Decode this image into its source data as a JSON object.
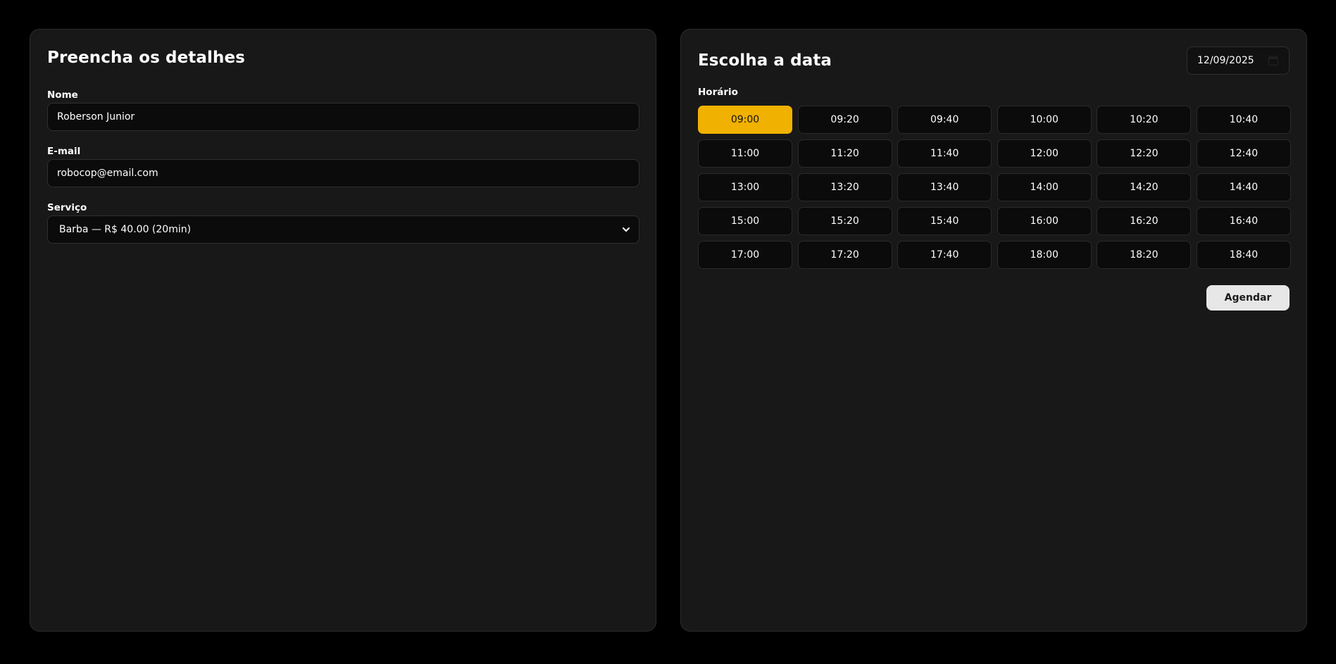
{
  "details": {
    "title": "Preencha os detalhes",
    "name_label": "Nome",
    "name_value": "Roberson Junior",
    "email_label": "E-mail",
    "email_value": "robocop@email.com",
    "service_label": "Serviço",
    "service_value": "Barba — R$ 40.00 (20min)"
  },
  "schedule": {
    "title": "Escolha a data",
    "date_value": "12/09/2025",
    "slots_label": "Horário",
    "selected_slot": "09:00",
    "slots": [
      "09:00",
      "09:20",
      "09:40",
      "10:00",
      "10:20",
      "10:40",
      "11:00",
      "11:20",
      "11:40",
      "12:00",
      "12:20",
      "12:40",
      "13:00",
      "13:20",
      "13:40",
      "14:00",
      "14:20",
      "14:40",
      "15:00",
      "15:20",
      "15:40",
      "16:00",
      "16:20",
      "16:40",
      "17:00",
      "17:20",
      "17:40",
      "18:00",
      "18:20",
      "18:40"
    ],
    "submit_label": "Agendar"
  },
  "colors": {
    "background": "#000000",
    "panel": "#181818",
    "accent": "#f0b100",
    "input_bg": "#0b0b0b"
  },
  "icons": {
    "service_select": "chevron-down-icon",
    "date_picker": "calendar-icon"
  }
}
